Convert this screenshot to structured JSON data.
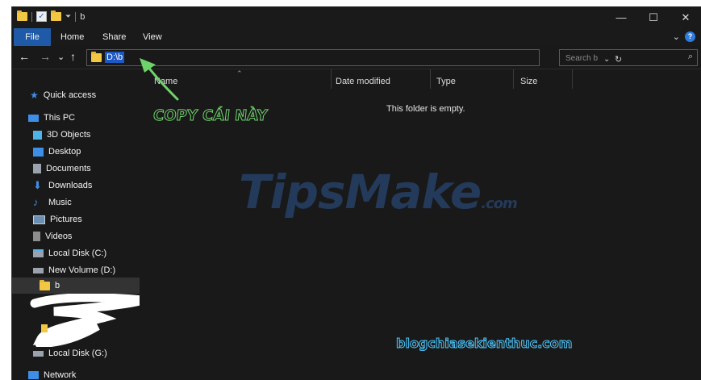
{
  "titlebar": {
    "title": "b",
    "controls": {
      "minimize": "—",
      "maximize": "☐",
      "close": "✕"
    }
  },
  "ribbon": {
    "tabs": [
      "File",
      "Home",
      "Share",
      "View"
    ],
    "expand_glyph": "⌄",
    "help_glyph": "?"
  },
  "nav": {
    "back": "←",
    "forward": "→",
    "recent": "⌄",
    "up": "↑",
    "address": "D:\\b",
    "refresh": "↻",
    "dropdown": "⌄",
    "search_placeholder": "Search b"
  },
  "sidebar": {
    "items": [
      {
        "label": "Quick access",
        "icon": "star-icon"
      },
      {
        "label": "This PC",
        "icon": "computer-icon"
      },
      {
        "label": "3D Objects",
        "icon": "cube-icon"
      },
      {
        "label": "Desktop",
        "icon": "desktop-icon"
      },
      {
        "label": "Documents",
        "icon": "document-icon"
      },
      {
        "label": "Downloads",
        "icon": "download-icon"
      },
      {
        "label": "Music",
        "icon": "music-icon"
      },
      {
        "label": "Pictures",
        "icon": "pictures-icon"
      },
      {
        "label": "Videos",
        "icon": "video-icon"
      },
      {
        "label": "Local Disk (C:)",
        "icon": "drive-icon"
      },
      {
        "label": "New Volume (D:)",
        "icon": "drive-icon"
      },
      {
        "label": "b",
        "icon": "folder-icon"
      },
      {
        "label": "Local Disk (G:)",
        "icon": "drive-icon"
      },
      {
        "label": "Network",
        "icon": "network-icon"
      }
    ]
  },
  "columns": [
    "Name",
    "Date modified",
    "Type",
    "Size"
  ],
  "empty_message": "This folder is empty.",
  "overlays": {
    "annotation": "COPY CÁI NÀY",
    "watermark": "TipsMake",
    "watermark_suffix": ".com",
    "blog_watermark": "blogchiasekienthuc.com"
  },
  "colors": {
    "accent": "#1f5aa8",
    "selection": "#1e58c2",
    "annotation": "#6fd36b",
    "blog": "#4dc9ff"
  }
}
